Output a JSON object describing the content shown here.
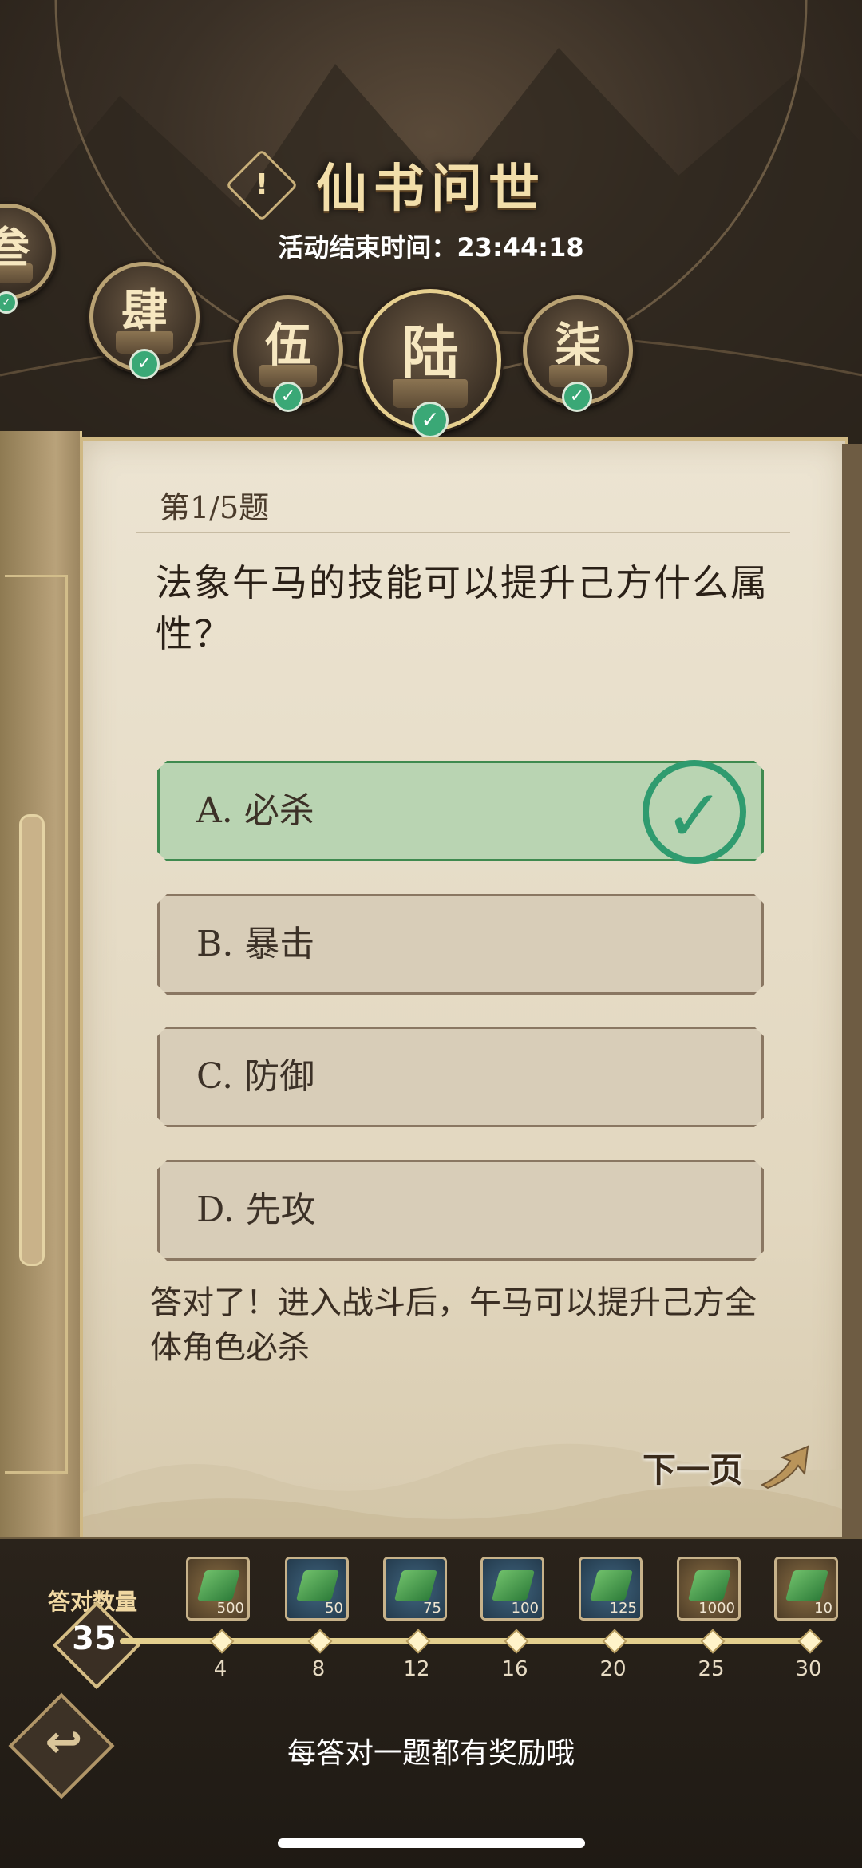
{
  "header": {
    "title": "仙书问世",
    "info_icon_label": "!",
    "end_time_label": "活动结束时间：",
    "end_time_value": "23:44:18"
  },
  "chapters": [
    {
      "label": "叁",
      "completed": true
    },
    {
      "label": "肆",
      "completed": true
    },
    {
      "label": "伍",
      "completed": true
    },
    {
      "label": "陆",
      "completed": true,
      "selected": true
    },
    {
      "label": "柒",
      "completed": true
    }
  ],
  "quiz": {
    "question_number": "第1/5题",
    "question": "法象午马的技能可以提升己方什么属性？",
    "options": [
      {
        "label": "A. 必杀",
        "correct": true
      },
      {
        "label": "B. 暴击",
        "correct": false
      },
      {
        "label": "C. 防御",
        "correct": false
      },
      {
        "label": "D. 先攻",
        "correct": false
      }
    ],
    "explanation": "答对了！进入战斗后，午马可以提升己方全体角色必杀",
    "next_label": "下一页"
  },
  "progress": {
    "label": "答对数量",
    "count": "35",
    "milestones": [
      {
        "value": "4",
        "reward_qty": "500",
        "reward_type": "gold"
      },
      {
        "value": "8",
        "reward_qty": "50",
        "reward_type": "blue"
      },
      {
        "value": "12",
        "reward_qty": "75",
        "reward_type": "blue"
      },
      {
        "value": "16",
        "reward_qty": "100",
        "reward_type": "blue"
      },
      {
        "value": "20",
        "reward_qty": "125",
        "reward_type": "blue"
      },
      {
        "value": "25",
        "reward_qty": "1000",
        "reward_type": "gold"
      },
      {
        "value": "30",
        "reward_qty": "10",
        "reward_type": "gold"
      }
    ]
  },
  "footer": {
    "hint": "每答对一题都有奖励哦",
    "back_icon": "↩"
  },
  "colors": {
    "correct_green": "#2f9b6f",
    "paper": "#e6dcc6",
    "accent_gold": "#d5bd84"
  }
}
